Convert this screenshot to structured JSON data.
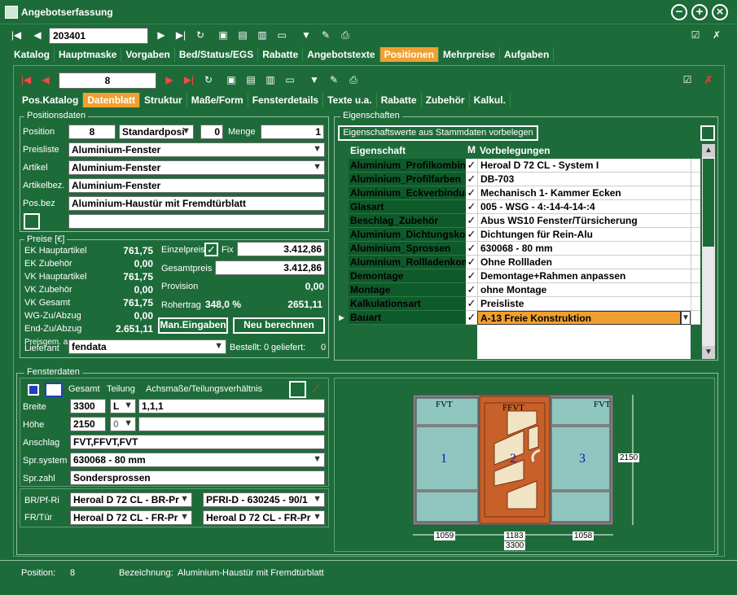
{
  "window": {
    "title": "Angebotserfassung"
  },
  "toolbar": {
    "record_number": "203401"
  },
  "main_tabs": [
    {
      "label": "Katalog"
    },
    {
      "label": "Hauptmaske"
    },
    {
      "label": "Vorgaben"
    },
    {
      "label": "Bed/Status/EGS"
    },
    {
      "label": "Rabatte"
    },
    {
      "label": "Angebotstexte"
    },
    {
      "label": "Positionen"
    },
    {
      "label": "Mehrpreise"
    },
    {
      "label": "Aufgaben"
    }
  ],
  "sub_toolbar": {
    "position_number": "8"
  },
  "sub_tabs": [
    {
      "label": "Pos.Katalog"
    },
    {
      "label": "Datenblatt"
    },
    {
      "label": "Struktur"
    },
    {
      "label": "Maße/Form"
    },
    {
      "label": "Fensterdetails"
    },
    {
      "label": "Texte u.a."
    },
    {
      "label": "Rabatte"
    },
    {
      "label": "Zubehör"
    },
    {
      "label": "Kalkul."
    }
  ],
  "positionsdaten": {
    "title": "Positionsdaten",
    "position_label": "Position",
    "position_value": "8",
    "position_type": "Standardposi",
    "zero_value": "0",
    "menge_label": "Menge",
    "menge_value": "1",
    "preisliste_label": "Preisliste",
    "preisliste_value": "Aluminium-Fenster",
    "artikel_label": "Artikel",
    "artikel_value": "Aluminium-Fenster",
    "artikelbez_label": "Artikelbez.",
    "artikelbez_value": "Aluminium-Fenster",
    "posbez_label": "Pos.bez",
    "posbez_value": "Aluminium-Haustür mit Fremdtürblatt"
  },
  "preise": {
    "title": "Preise [€]",
    "rows": [
      {
        "label": "EK Hauptartikel",
        "value": "761,75"
      },
      {
        "label": "EK Zubehör",
        "value": "0,00"
      },
      {
        "label": "VK Hauptartikel",
        "value": "761,75"
      },
      {
        "label": "VK Zubehör",
        "value": "0,00"
      },
      {
        "label": "VK Gesamt",
        "value": "761,75"
      },
      {
        "label": "WG-Zu/Abzug",
        "value": "0,00"
      },
      {
        "label": "End-Zu/Abzug",
        "value": "2.651,11"
      }
    ],
    "einzelpreis_label": "Einzelpreis",
    "fix_label": "Fix",
    "einzelpreis_value": "3.412,86",
    "gesamtpreis_label": "Gesamtpreis",
    "gesamtpreis_value": "3.412,86",
    "provision_label": "Provision",
    "provision_value": "0,00",
    "rohertrag_label": "Rohertrag",
    "rohertrag_percent": "348,0 %",
    "rohertrag_value": "2651,11",
    "man_eingaben_label": "Man.Eingaben",
    "neu_berechnen_label": "Neu berechnen",
    "preisgem_label": "Preisgem. a",
    "lieferant_label": "Lieferant",
    "lieferant_value": "fendata",
    "bestellt_label": "Bestellt:",
    "bestellt_value": "0",
    "geliefert_label": "geliefert:",
    "geliefert_value": "0"
  },
  "eigenschaften": {
    "title": "Eigenschaften",
    "vorbelegen_button": "Eigenschaftswerte aus Stammdaten vorbelegen",
    "col_eigenschaft": "Eigenschaft",
    "col_m": "M",
    "col_vorbelegungen": "Vorbelegungen",
    "rows": [
      {
        "name": "Aluminium_Profilkombinat",
        "check": "✓",
        "value": "Heroal D 72 CL - System I"
      },
      {
        "name": "Aluminium_Profilfarben",
        "check": "✓",
        "value": "DB-703"
      },
      {
        "name": "Aluminium_Eckverbindun",
        "check": "✓",
        "value": "Mechanisch 1- Kammer Ecken"
      },
      {
        "name": "Glasart",
        "check": "✓",
        "value": "005 - WSG - 4:-14-4-14-:4"
      },
      {
        "name": "Beschlag_Zubehör",
        "check": "✓",
        "value": "Abus WS10 Fenster/Türsicherung"
      },
      {
        "name": "Aluminium_Dichtungskom",
        "check": "✓",
        "value": "Dichtungen für Rein-Alu"
      },
      {
        "name": "Aluminium_Sprossen",
        "check": "✓",
        "value": "630068 - 80 mm"
      },
      {
        "name": "Aluminium_Rollladenkom",
        "check": "✓",
        "value": "Ohne Rollladen"
      },
      {
        "name": "Demontage",
        "check": "✓",
        "value": "Demontage+Rahmen anpassen"
      },
      {
        "name": "Montage",
        "check": "✓",
        "value": "ohne Montage"
      },
      {
        "name": "Kalkulationsart",
        "check": "✓",
        "value": "Preisliste"
      },
      {
        "name": "Bauart",
        "check": "✓",
        "value": "A-13  Freie Konstruktion"
      }
    ]
  },
  "fensterdaten": {
    "title": "Fensterdaten",
    "gesamt_label": "Gesamt",
    "teilung_label": "Teilung",
    "achsmasse_label": "Achsmaße/Teilungsverhältnis",
    "breite_label": "Breite",
    "breite_value": "3300",
    "breite_unit": "L",
    "breite_teilung": "1,1,1",
    "hoehe_label": "Höhe",
    "hoehe_value": "2150",
    "hoehe_unit": "0",
    "anschlag_label": "Anschlag",
    "anschlag_value": "FVT,FFVT,FVT",
    "sprsystem_label": "Spr.system",
    "sprsystem_value": "630068 - 80 mm",
    "sprzahl_label": "Spr.zahl",
    "sprzahl_value": "Sondersprossen",
    "brpfri_label": "BR/Pf-Ri",
    "brpfri_value1": "Heroal D 72 CL - BR-Pr",
    "brpfri_value2": "PFRI-D - 630245 - 90/1",
    "frtuer_label": "FR/Tür",
    "frtuer_value1": "Heroal D 72 CL - FR-Pr",
    "frtuer_value2": "Heroal D 72 CL - FR-Pr"
  },
  "drawing": {
    "pane_labels": [
      "FVT",
      "FFVT",
      "FVT"
    ],
    "pane_numbers": [
      "1",
      "2",
      "3"
    ],
    "height_dim": "2150",
    "width_dims": [
      "1059",
      "1183",
      "1058"
    ],
    "total_width": "3300"
  },
  "statusbar": {
    "position_label": "Position:",
    "position_value": "8",
    "bezeichnung_label": "Bezeichnung:",
    "bezeichnung_value": "Aluminium-Haustür mit Fremdtürblatt"
  }
}
